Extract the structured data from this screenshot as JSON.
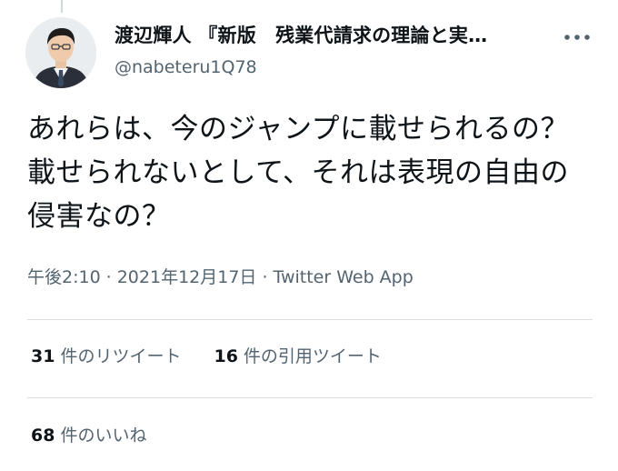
{
  "author": {
    "display_name": "渡辺輝人 『新版　残業代請求の理論と実…",
    "handle": "@nabeteru1Q78"
  },
  "tweet": {
    "text": "あれらは、今のジャンプに載せられるの？載せられないとして、それは表現の自由の侵害なの？"
  },
  "meta": {
    "time": "午後2:10",
    "date": "2021年12月17日",
    "source": "Twitter Web App"
  },
  "stats": {
    "retweets": {
      "count": "31",
      "label": "件のリツイート"
    },
    "quotes": {
      "count": "16",
      "label": "件の引用ツイート"
    },
    "likes": {
      "count": "68",
      "label": "件のいいね"
    }
  },
  "icons": {
    "more": "more-horizontal-icon",
    "avatar": "profile-photo"
  }
}
